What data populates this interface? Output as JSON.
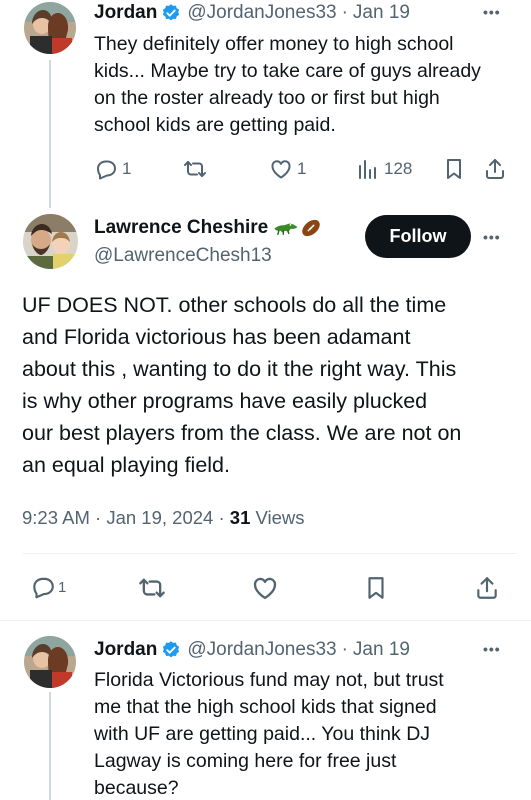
{
  "reply1": {
    "name": "Jordan",
    "handle": "@JordanJones33",
    "sep": "·",
    "date": "Jan 19",
    "more": "•••",
    "text_lines": [
      "They definitely offer money to high school",
      "kids... Maybe try to take care of guys already",
      "on the roster already too or first but high",
      "school kids are getting paid."
    ],
    "replies": "1",
    "likes": "1",
    "views": "128"
  },
  "main": {
    "name": "Lawrence Cheshire",
    "handle": "@LawrenceChesh13",
    "follow_label": "Follow",
    "more": "•••",
    "text_lines": [
      "UF DOES NOT. other schools do all the time",
      "and Florida victorious has been adamant",
      "about this , wanting to do it the right way. This",
      "is why other programs have easily plucked",
      "our best players from the class. We are not on",
      "an equal playing field."
    ],
    "time": "9:23 AM",
    "date": "Jan 19, 2024",
    "sep": "·",
    "views_count": "31",
    "views_label": "Views",
    "replies": "1"
  },
  "reply2": {
    "name": "Jordan",
    "handle": "@JordanJones33",
    "sep": "·",
    "date": "Jan 19",
    "more": "•••",
    "text_lines": [
      "Florida Victorious fund may not, but trust",
      "me that the high school kids that signed",
      "with UF are getting paid... You think DJ",
      "Lagway is coming here for free just",
      "because?"
    ]
  },
  "colors": {
    "verified": "#1d9bf0",
    "text": "#0f1419",
    "muted": "#536471",
    "follow_bg": "#0f1419"
  },
  "icons": {
    "reply": "reply-icon",
    "retweet": "retweet-icon",
    "like": "heart-icon",
    "views": "views-icon",
    "bookmark": "bookmark-icon",
    "share": "share-icon",
    "verified": "verified-badge-icon",
    "gator": "gator-emoji-icon",
    "football": "football-emoji-icon"
  }
}
